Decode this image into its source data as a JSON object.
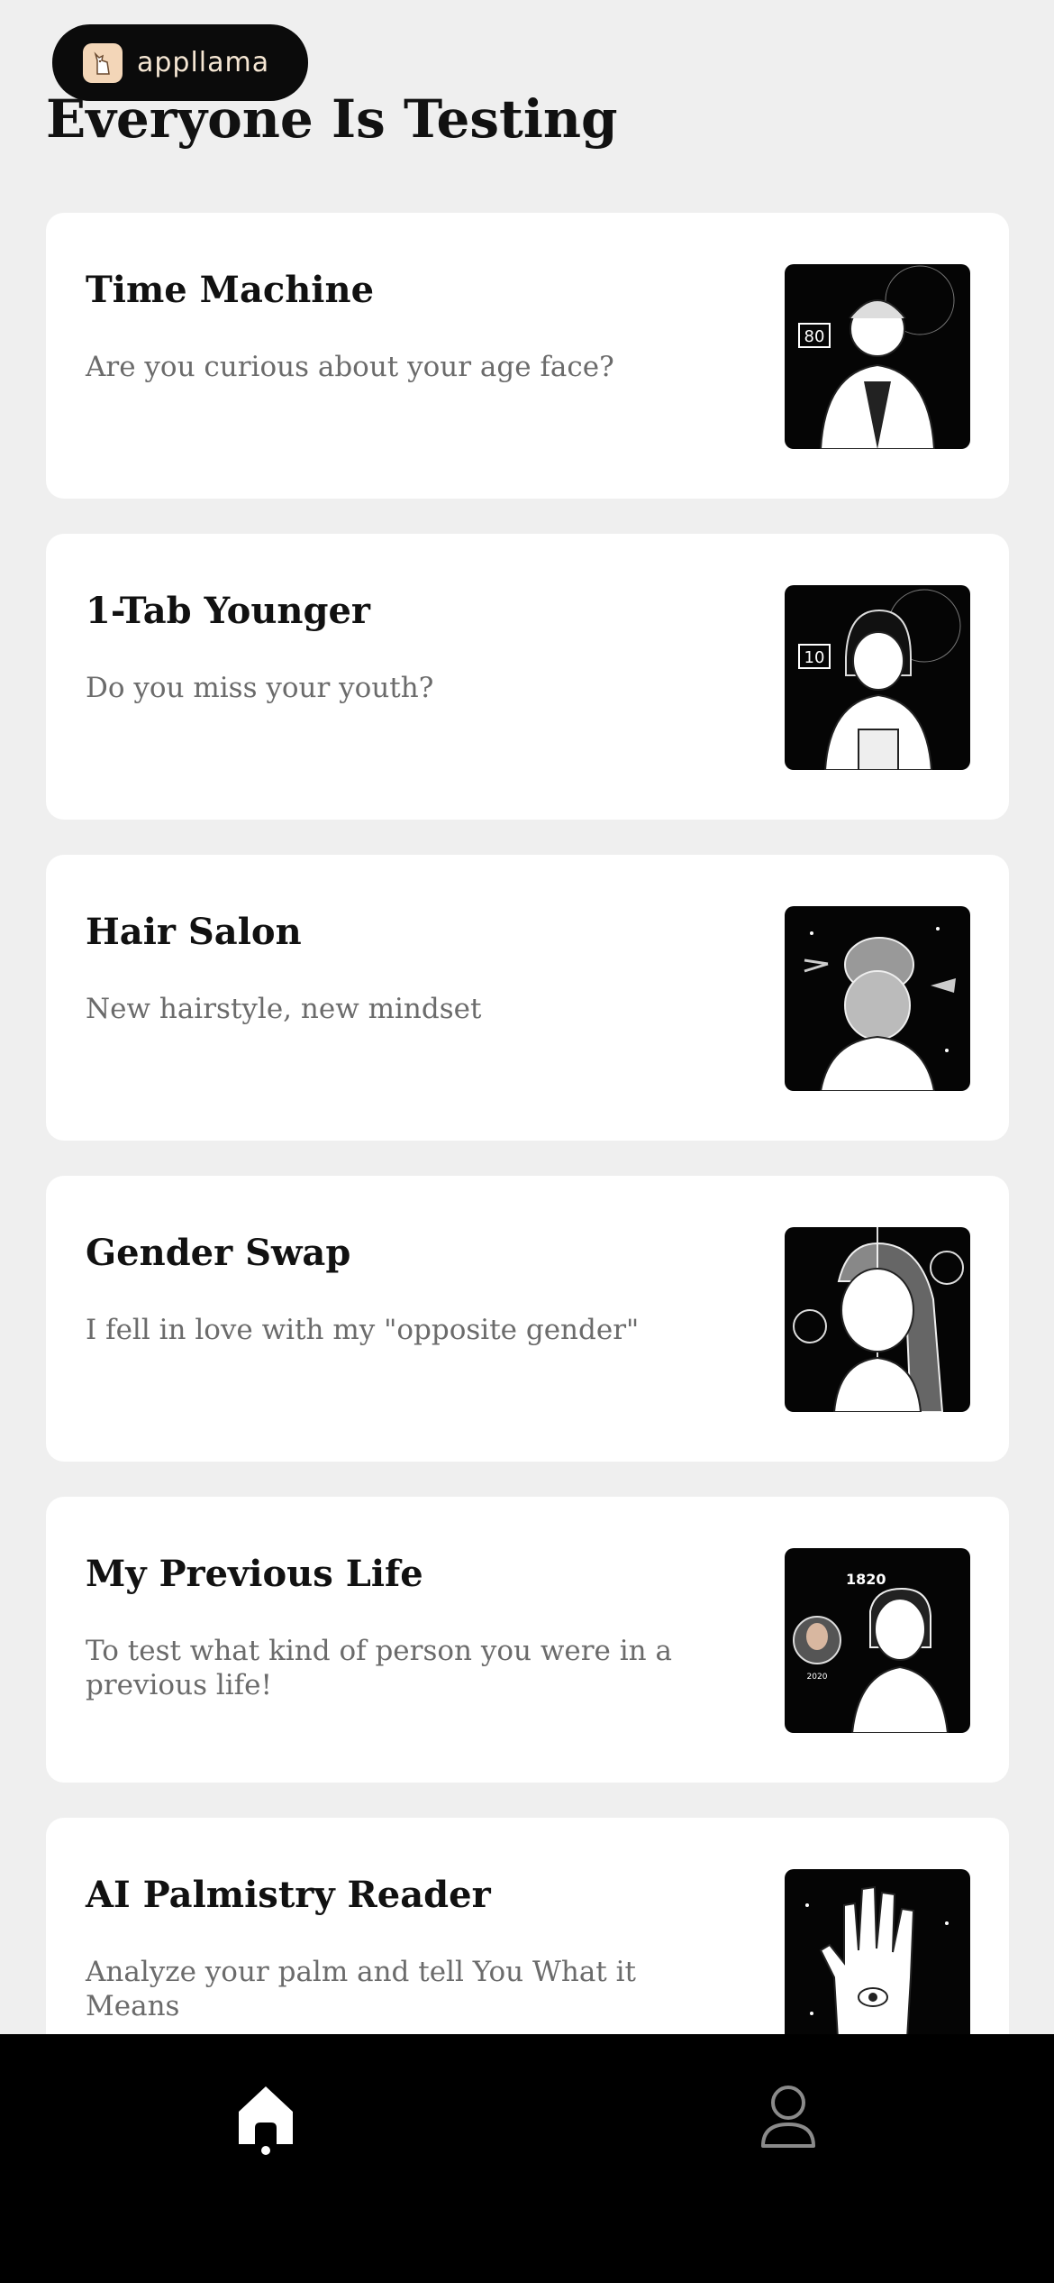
{
  "brand": {
    "name": "appllama",
    "logo_icon": "llama-icon"
  },
  "section_title": "Everyone Is Testing",
  "cards": [
    {
      "title": "Time Machine",
      "description": "Are you curious about your age face?",
      "thumb_icon": "elderly-woman-portrait-icon",
      "thumb_badge": "80"
    },
    {
      "title": "1-Tab Younger",
      "description": "Do you miss your youth?",
      "thumb_icon": "young-girl-portrait-icon",
      "thumb_badge": "10"
    },
    {
      "title": "Hair Salon",
      "description": "New hairstyle, new mindset",
      "thumb_icon": "hairstyle-portrait-icon"
    },
    {
      "title": "Gender Swap",
      "description": "I fell in love with my \"opposite gender\"",
      "thumb_icon": "gender-swap-portrait-icon"
    },
    {
      "title": "My Previous Life",
      "description": "To test what kind of person you were in a previous life!",
      "thumb_icon": "previous-life-portrait-icon",
      "thumb_badge": "1820",
      "thumb_badge_small": "2020"
    },
    {
      "title": "AI Palmistry Reader",
      "description": "Analyze your palm and tell You What it Means",
      "thumb_icon": "palm-hand-icon"
    }
  ],
  "bottom_nav": {
    "items": [
      {
        "name": "home",
        "icon": "home-icon",
        "active": true
      },
      {
        "name": "profile",
        "icon": "profile-icon",
        "active": false
      }
    ]
  },
  "colors": {
    "background": "#efefef",
    "card": "#ffffff",
    "nav": "#000000",
    "description": "#6b6b6b",
    "brand_pill": "#0b0b0b"
  }
}
